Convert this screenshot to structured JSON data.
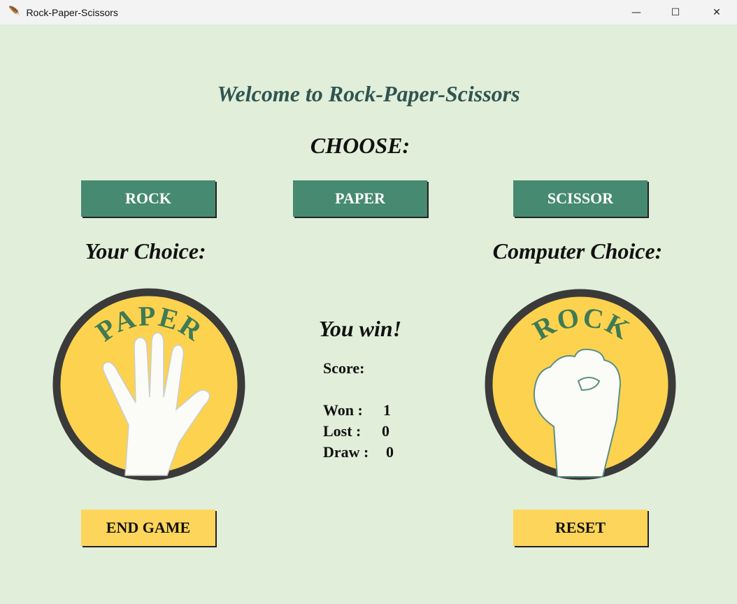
{
  "window": {
    "title": "Rock-Paper-Scissors",
    "minimize": "—",
    "maximize": "☐",
    "close": "✕"
  },
  "header": {
    "title": "Welcome to Rock-Paper-Scissors",
    "choose": "CHOOSE:"
  },
  "choices": {
    "rock": "ROCK",
    "paper": "PAPER",
    "scissor": "SCISSOR"
  },
  "player": {
    "label": "Your Choice:",
    "image_text": "PAPER"
  },
  "computer": {
    "label": "Computer Choice:",
    "image_text": "ROCK"
  },
  "result": {
    "message": "You win!",
    "score_label": "Score:",
    "won_label": "Won  :",
    "won": "1",
    "lost_label": "Lost  :",
    "lost": "0",
    "draw_label": "Draw :",
    "draw": "0"
  },
  "actions": {
    "end_game": "END GAME",
    "reset": "RESET"
  },
  "colors": {
    "background": "#e1eed9",
    "button_green": "#468a72",
    "button_yellow": "#fdd55b",
    "badge_yellow": "#fcd24f"
  }
}
